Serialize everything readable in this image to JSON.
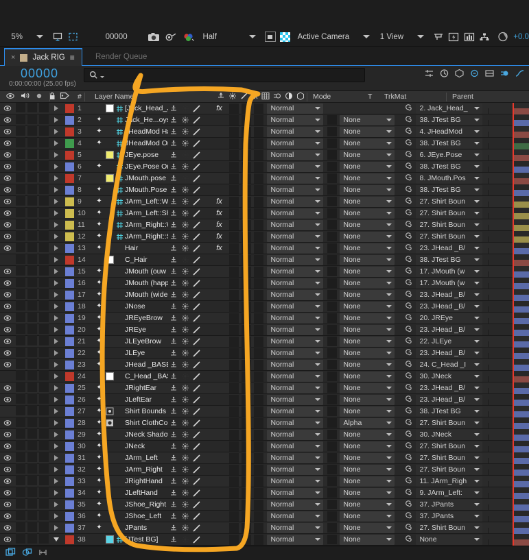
{
  "toolbar": {
    "zoom_level": "5%",
    "timecode": "00000",
    "resolution": "Half",
    "camera": "Active Camera",
    "view": "1 View",
    "exposure": "+0.0",
    "icons": [
      "region-of-interest-icon",
      "transparency-grid-icon",
      "camera-snapshot-icon",
      "show-snapshot-icon",
      "channel-color-icon",
      "toggle-mask-icon",
      "checkerboard-icon",
      "timeline-icon",
      "fast-preview-icon",
      "render-graph-icon",
      "flowchart-icon",
      "exposure-icon"
    ]
  },
  "tabs": {
    "active": {
      "label": "Jack RIG",
      "close_icon": "close-icon",
      "menu_icon": "panel-menu-icon",
      "swatch_color": "#c3ae8a"
    },
    "inactive": {
      "label": "Render Queue"
    }
  },
  "timecode_panel": {
    "current_time": "00000",
    "time_detail": "0:00:00:00 (25.00 fps)",
    "search_icon": "search-icon",
    "right_icons": [
      "composition-mini-flowchart-icon",
      "live-update-icon",
      "draft-3d-icon",
      "hide-shy-icon",
      "frame-blending-icon",
      "motion-blur-icon",
      "graph-editor-icon"
    ]
  },
  "columns": {
    "switches": [
      "video-eye-icon",
      "audio-speaker-icon",
      "solo-icon",
      "lock-icon"
    ],
    "label_icon": "label-tag-icon",
    "number": "#",
    "layer_name": "Layer Name",
    "switch_icons": [
      "shy-icon",
      "collapse-transformations-icon",
      "quality-icon",
      "effects-fx-icon",
      "frame-blend-icon",
      "motion-blur-icon",
      "adjustment-layer-icon",
      "3d-layer-icon"
    ],
    "mode": "Mode",
    "t": "T",
    "trkmat": "TrkMat",
    "parent": "Parent"
  },
  "colors": {
    "red": "#c0392b",
    "blue": "#6b7fd4",
    "green": "#3f9b4d",
    "yellow": "#f0ec6e",
    "gold": "#cdbc4f",
    "cyan": "#5ad4e6",
    "white": "#ffffff",
    "accent_blue": "#2d8ceb",
    "playhead_red": "#e8392c",
    "annotation_orange": "#f5a623"
  },
  "layers": [
    {
      "num": "1",
      "name": "[Jack_Head_Joystick]",
      "color": "#c0392b",
      "bar": "#8a4a44",
      "visible": true,
      "type": "comp-white",
      "star": false,
      "mode": "Normal",
      "trkmat": null,
      "parent": "2. Jack_Head_",
      "fx": true,
      "shy": false,
      "open": false
    },
    {
      "num": "2",
      "name": "Jack_He...oystick Origin",
      "color": "#6b7fd4",
      "bar": "#5a6aa8",
      "visible": true,
      "type": "comp",
      "star": true,
      "mode": "Normal",
      "trkmat": "None",
      "parent": "38. JTest BG",
      "fx": false,
      "shy": true,
      "open": false
    },
    {
      "num": "3",
      "name": "JHeadMod Handle",
      "color": "#c0392b",
      "bar": "#8a4a44",
      "visible": true,
      "type": "comp",
      "star": true,
      "mode": "Normal",
      "trkmat": "None",
      "parent": "4. JHeadMod ",
      "fx": false,
      "shy": true,
      "open": false
    },
    {
      "num": "4",
      "name": "JHeadMod Origin",
      "color": "#3f9b4d",
      "bar": "#3f6b45",
      "visible": true,
      "type": "comp",
      "star": true,
      "mode": "Normal",
      "trkmat": "None",
      "parent": "38. JTest BG",
      "fx": false,
      "shy": true,
      "open": false
    },
    {
      "num": "5",
      "name": "JEye.pose",
      "color": "#c0392b",
      "bar": "#8a4a44",
      "visible": true,
      "type": "solid-yellow",
      "star": false,
      "mode": "Normal",
      "trkmat": "None",
      "parent": "6. JEye.Pose ",
      "fx": false,
      "shy": false,
      "open": false
    },
    {
      "num": "6",
      "name": "JEye.Pose Origin",
      "color": "#6b7fd4",
      "bar": "#5a6aa8",
      "visible": true,
      "type": "comp",
      "star": true,
      "mode": "Normal",
      "trkmat": "None",
      "parent": "38. JTest BG",
      "fx": false,
      "shy": true,
      "open": false
    },
    {
      "num": "7",
      "name": "JMouth.pose",
      "color": "#c0392b",
      "bar": "#8a4a44",
      "visible": true,
      "type": "solid-yellow",
      "star": false,
      "mode": "Normal",
      "trkmat": "None",
      "parent": "8. JMouth.Pos",
      "fx": false,
      "shy": false,
      "open": false
    },
    {
      "num": "8",
      "name": "JMouth.Pose Origin",
      "color": "#6b7fd4",
      "bar": "#5a6aa8",
      "visible": true,
      "type": "comp",
      "star": true,
      "mode": "Normal",
      "trkmat": "None",
      "parent": "38. JTest BG",
      "fx": false,
      "shy": true,
      "open": false
    },
    {
      "num": "9",
      "name": "JArm_Left::Wrist",
      "color": "#cdbc4f",
      "bar": "#9a8f4a",
      "visible": true,
      "type": "comp",
      "star": true,
      "mode": "Normal",
      "trkmat": "None",
      "parent": "27. Shirt Boun",
      "fx": true,
      "shy": true,
      "open": false
    },
    {
      "num": "10",
      "name": "JArm_Left::Shoulder",
      "color": "#cdbc4f",
      "bar": "#9a8f4a",
      "visible": true,
      "type": "comp",
      "star": true,
      "mode": "Normal",
      "trkmat": "None",
      "parent": "27. Shirt Boun",
      "fx": true,
      "shy": true,
      "open": false
    },
    {
      "num": "11",
      "name": "JArm_Right::Wrist",
      "color": "#cdbc4f",
      "bar": "#9a8f4a",
      "visible": true,
      "type": "comp",
      "star": true,
      "mode": "Normal",
      "trkmat": "None",
      "parent": "27. Shirt Boun",
      "fx": true,
      "shy": true,
      "open": false
    },
    {
      "num": "12",
      "name": "JArm_Right::Shoulder",
      "color": "#cdbc4f",
      "bar": "#9a8f4a",
      "visible": true,
      "type": "comp",
      "star": true,
      "mode": "Normal",
      "trkmat": "None",
      "parent": "27. Shirt Boun",
      "fx": true,
      "shy": true,
      "open": false
    },
    {
      "num": "13",
      "name": "Hair",
      "color": "#6b7fd4",
      "bar": "#5a6aa8",
      "visible": true,
      "type": "none",
      "star": true,
      "mode": "Normal",
      "trkmat": "None",
      "parent": "23. JHead _B/",
      "fx": true,
      "shy": true,
      "open": false
    },
    {
      "num": "14",
      "name": "C_Hair",
      "color": "#c0392b",
      "bar": "#8a4a44",
      "visible": false,
      "type": "solid-white",
      "star": false,
      "mode": "Normal",
      "trkmat": "None",
      "parent": "38. JTest BG",
      "fx": false,
      "shy": false,
      "open": false
    },
    {
      "num": "15",
      "name": "JMouth (ouw open)",
      "color": "#6b7fd4",
      "bar": "#5a6aa8",
      "visible": true,
      "type": "none",
      "star": true,
      "mode": "Normal",
      "trkmat": "None",
      "parent": "17. JMouth (w",
      "fx": false,
      "shy": true,
      "open": false
    },
    {
      "num": "16",
      "name": "JMouth (happy close)",
      "color": "#6b7fd4",
      "bar": "#5a6aa8",
      "visible": true,
      "type": "none",
      "star": true,
      "mode": "Normal",
      "trkmat": "None",
      "parent": "17. JMouth (w",
      "fx": false,
      "shy": true,
      "open": false
    },
    {
      "num": "17",
      "name": "JMouth (wide open)",
      "color": "#6b7fd4",
      "bar": "#5a6aa8",
      "visible": true,
      "type": "none",
      "star": true,
      "mode": "Normal",
      "trkmat": "None",
      "parent": "23. JHead _B/",
      "fx": false,
      "shy": true,
      "open": false
    },
    {
      "num": "18",
      "name": "JNose",
      "color": "#6b7fd4",
      "bar": "#5a6aa8",
      "visible": true,
      "type": "none",
      "star": true,
      "mode": "Normal",
      "trkmat": "None",
      "parent": "23. JHead _B/",
      "fx": false,
      "shy": true,
      "open": false
    },
    {
      "num": "19",
      "name": "JREyeBrow",
      "color": "#6b7fd4",
      "bar": "#5a6aa8",
      "visible": true,
      "type": "none",
      "star": true,
      "mode": "Normal",
      "trkmat": "None",
      "parent": "20. JREye",
      "fx": false,
      "shy": true,
      "open": false
    },
    {
      "num": "20",
      "name": "JREye",
      "color": "#6b7fd4",
      "bar": "#5a6aa8",
      "visible": true,
      "type": "none",
      "star": true,
      "mode": "Normal",
      "trkmat": "None",
      "parent": "23. JHead _B/",
      "fx": false,
      "shy": true,
      "open": false
    },
    {
      "num": "21",
      "name": "JLEyeBrow",
      "color": "#6b7fd4",
      "bar": "#5a6aa8",
      "visible": true,
      "type": "none",
      "star": true,
      "mode": "Normal",
      "trkmat": "None",
      "parent": "22. JLEye",
      "fx": false,
      "shy": true,
      "open": false
    },
    {
      "num": "22",
      "name": "JLEye",
      "color": "#6b7fd4",
      "bar": "#5a6aa8",
      "visible": true,
      "type": "none",
      "star": true,
      "mode": "Normal",
      "trkmat": "None",
      "parent": "23. JHead _B/",
      "fx": false,
      "shy": true,
      "open": false
    },
    {
      "num": "23",
      "name": "JHead _BASE",
      "color": "#6b7fd4",
      "bar": "#5a6aa8",
      "visible": true,
      "type": "none",
      "star": true,
      "mode": "Normal",
      "trkmat": "None",
      "parent": "24. C_Head _I",
      "fx": false,
      "shy": true,
      "open": false
    },
    {
      "num": "24",
      "name": "C_Head _BASE",
      "color": "#c0392b",
      "bar": "#8a4a44",
      "visible": false,
      "type": "solid-white",
      "star": false,
      "mode": "Normal",
      "trkmat": "None",
      "parent": "30. JNeck",
      "fx": false,
      "shy": false,
      "open": false
    },
    {
      "num": "25",
      "name": "JRightEar",
      "color": "#6b7fd4",
      "bar": "#5a6aa8",
      "visible": true,
      "type": "none",
      "star": true,
      "mode": "Normal",
      "trkmat": "None",
      "parent": "23. JHead _B/",
      "fx": false,
      "shy": true,
      "open": false
    },
    {
      "num": "26",
      "name": "JLeftEar",
      "color": "#6b7fd4",
      "bar": "#5a6aa8",
      "visible": true,
      "type": "none",
      "star": true,
      "mode": "Normal",
      "trkmat": "None",
      "parent": "23. JHead _B/",
      "fx": false,
      "shy": true,
      "open": false
    },
    {
      "num": "27",
      "name": "Shirt Bounds",
      "color": "#6b7fd4",
      "bar": "#5a6aa8",
      "visible": false,
      "type": "puppet",
      "star": true,
      "mode": "Normal",
      "trkmat": "None",
      "parent": "38. JTest BG",
      "fx": false,
      "shy": true,
      "open": false
    },
    {
      "num": "28",
      "name": "Shirt ClothColor",
      "color": "#6b7fd4",
      "bar": "#5a6aa8",
      "visible": true,
      "type": "puppet-filled",
      "star": true,
      "mode": "Normal",
      "trkmat": "Alpha",
      "parent": "27. Shirt Boun",
      "fx": false,
      "shy": true,
      "open": false
    },
    {
      "num": "29",
      "name": "JNeck Shadow",
      "color": "#6b7fd4",
      "bar": "#5a6aa8",
      "visible": true,
      "type": "none",
      "star": true,
      "mode": "Normal",
      "trkmat": "None",
      "parent": "30. JNeck",
      "fx": false,
      "shy": true,
      "open": false
    },
    {
      "num": "30",
      "name": "JNeck",
      "color": "#6b7fd4",
      "bar": "#5a6aa8",
      "visible": true,
      "type": "none",
      "star": true,
      "mode": "Normal",
      "trkmat": "None",
      "parent": "27. Shirt Boun",
      "fx": false,
      "shy": true,
      "open": false
    },
    {
      "num": "31",
      "name": "JArm_Left",
      "color": "#6b7fd4",
      "bar": "#5a6aa8",
      "visible": true,
      "type": "none",
      "star": true,
      "mode": "Normal",
      "trkmat": "None",
      "parent": "27. Shirt Boun",
      "fx": false,
      "shy": true,
      "open": false
    },
    {
      "num": "32",
      "name": "JArm_Right",
      "color": "#6b7fd4",
      "bar": "#5a6aa8",
      "visible": true,
      "type": "none",
      "star": true,
      "mode": "Normal",
      "trkmat": "None",
      "parent": "27. Shirt Boun",
      "fx": false,
      "shy": true,
      "open": false
    },
    {
      "num": "33",
      "name": "JRightHand",
      "color": "#6b7fd4",
      "bar": "#5a6aa8",
      "visible": true,
      "type": "none",
      "star": true,
      "mode": "Normal",
      "trkmat": "None",
      "parent": "11. JArm_Righ",
      "fx": false,
      "shy": true,
      "open": false
    },
    {
      "num": "34",
      "name": "JLeftHand",
      "color": "#6b7fd4",
      "bar": "#5a6aa8",
      "visible": true,
      "type": "none",
      "star": true,
      "mode": "Normal",
      "trkmat": "None",
      "parent": "9. JArm_Left:",
      "fx": false,
      "shy": true,
      "open": false
    },
    {
      "num": "35",
      "name": "JShoe_Right",
      "color": "#6b7fd4",
      "bar": "#5a6aa8",
      "visible": true,
      "type": "none",
      "star": true,
      "mode": "Normal",
      "trkmat": "None",
      "parent": "37. JPants",
      "fx": false,
      "shy": true,
      "open": false
    },
    {
      "num": "36",
      "name": "JShoe_Left",
      "color": "#6b7fd4",
      "bar": "#5a6aa8",
      "visible": true,
      "type": "none",
      "star": true,
      "mode": "Normal",
      "trkmat": "None",
      "parent": "37. JPants",
      "fx": false,
      "shy": true,
      "open": false
    },
    {
      "num": "37",
      "name": "JPants",
      "color": "#6b7fd4",
      "bar": "#5a6aa8",
      "visible": true,
      "type": "none",
      "star": true,
      "mode": "Normal",
      "trkmat": "None",
      "parent": "27. Shirt Boun",
      "fx": false,
      "shy": true,
      "open": false
    },
    {
      "num": "38",
      "name": "[JTest BG]",
      "color": "#c0392b",
      "bar": "#8a4a44",
      "visible": true,
      "type": "comp-cyan",
      "star": false,
      "mode": "Normal",
      "trkmat": "None",
      "parent": "None",
      "fx": false,
      "shy": false,
      "open": true
    }
  ],
  "bottom_bar": {
    "icons": [
      "toggle-switches-modes-icon",
      "comp-render-icon",
      "stretch-handle-icon"
    ]
  },
  "annotation": {
    "shape": "hand-drawn-orange-loop",
    "color": "#f5a623"
  }
}
